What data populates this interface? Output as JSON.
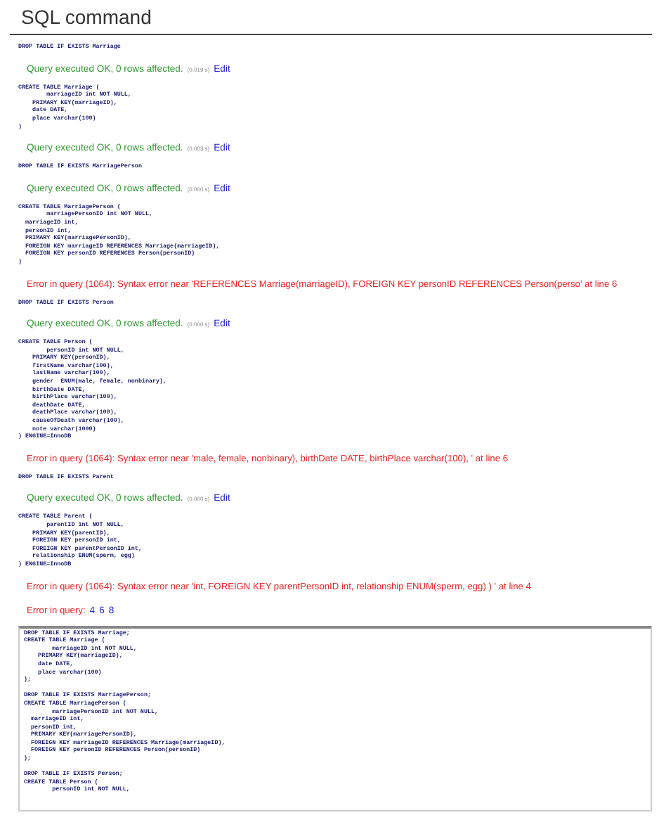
{
  "title": "SQL command",
  "results": [
    {
      "kind": "query",
      "lines": [
        "DROP TABLE IF EXISTS Marriage"
      ]
    },
    {
      "kind": "ok",
      "message": "Query executed OK, 0 rows affected.",
      "time": "(0.019 s)",
      "link": "Edit"
    },
    {
      "kind": "query",
      "lines": [
        "CREATE TABLE Marriage (",
        "        marriageID int NOT NULL,",
        "    PRIMARY KEY(marriageID),",
        "    date DATE,",
        "    place varchar(100)",
        ")"
      ]
    },
    {
      "kind": "ok",
      "message": "Query executed OK, 0 rows affected.",
      "time": "(0.003 s)",
      "link": "Edit"
    },
    {
      "kind": "query",
      "lines": [
        "DROP TABLE IF EXISTS MarriagePerson"
      ]
    },
    {
      "kind": "ok",
      "message": "Query executed OK, 0 rows affected.",
      "time": "(0.000 s)",
      "link": "Edit"
    },
    {
      "kind": "query",
      "lines": [
        "CREATE TABLE MarriagePerson (",
        "        marriagePersonID int NOT NULL,",
        "  marriageID int,",
        "  personID int,",
        "  PRIMARY KEY(marriagePersonID),",
        "  FOREIGN KEY marriageID REFERENCES Marriage(marriageID),",
        "  FOREIGN KEY personID REFERENCES Person(personID)",
        ")"
      ]
    },
    {
      "kind": "error",
      "message": "Error in query (1064): Syntax error near 'REFERENCES Marriage(marriageID), FOREIGN KEY personID REFERENCES Person(perso' at line 6"
    },
    {
      "kind": "query",
      "lines": [
        "DROP TABLE IF EXISTS Person"
      ]
    },
    {
      "kind": "ok",
      "message": "Query executed OK, 0 rows affected.",
      "time": "(0.000 s)",
      "link": "Edit"
    },
    {
      "kind": "query",
      "lines": [
        "CREATE TABLE Person (",
        "        personID int NOT NULL,",
        "    PRIMARY KEY(personID),",
        "    firstName varchar(100),",
        "    lastName varchar(100),",
        "    gender  ENUM(male, female, nonbinary),",
        "    birthDate DATE,",
        "    birthPlace varchar(100),",
        "    deathDate DATE,",
        "    deathPlace varchar(100),",
        "    causeOfDeath varchar(100),",
        "    note varchar(1000)",
        ") ENGINE=InnoDB"
      ]
    },
    {
      "kind": "error",
      "message": "Error in query (1064): Syntax error near 'male, female, nonbinary), birthDate DATE, birthPlace varchar(100), ' at line 6"
    },
    {
      "kind": "query",
      "lines": [
        "DROP TABLE IF EXISTS Parent"
      ]
    },
    {
      "kind": "ok",
      "message": "Query executed OK, 0 rows affected.",
      "time": "(0.000 s)",
      "link": "Edit"
    },
    {
      "kind": "query",
      "lines": [
        "CREATE TABLE Parent (",
        "        parentID int NOT NULL,",
        "    PRIMARY KEY(parentID),",
        "    FOREIGN KEY personID int,",
        "    FOREIGN KEY parentPersonID int,",
        "    relationship ENUM(sperm, egg)",
        ") ENGINE=InnoDB"
      ]
    },
    {
      "kind": "error",
      "message": "Error in query (1064): Syntax error near 'int, FOREIGN KEY parentPersonID int, relationship ENUM(sperm, egg) ) ' at line 4"
    }
  ],
  "summary": {
    "label": "Error in query:",
    "links": [
      "4",
      "6",
      "8"
    ]
  },
  "editor": {
    "value": [
      [
        "DROP TABLE IF EXISTS Marriage;",
        "CREATE TABLE Marriage (",
        "        marriageID int NOT NULL,",
        "    PRIMARY KEY(marriageID),",
        "    date DATE,",
        "    place varchar(100)",
        ");"
      ],
      [
        "DROP TABLE IF EXISTS MarriagePerson;",
        "CREATE TABLE MarriagePerson (",
        "        marriagePersonID int NOT NULL,",
        "  marriageID int,",
        "  personID int,",
        "  PRIMARY KEY(marriagePersonID),",
        "  FOREIGN KEY marriageID REFERENCES Marriage(marriageID),",
        "  FOREIGN KEY personID REFERENCES Person(personID)",
        ");"
      ],
      [
        "DROP TABLE IF EXISTS Person;",
        "CREATE TABLE Person (",
        "        personID int NOT NULL,"
      ]
    ]
  }
}
